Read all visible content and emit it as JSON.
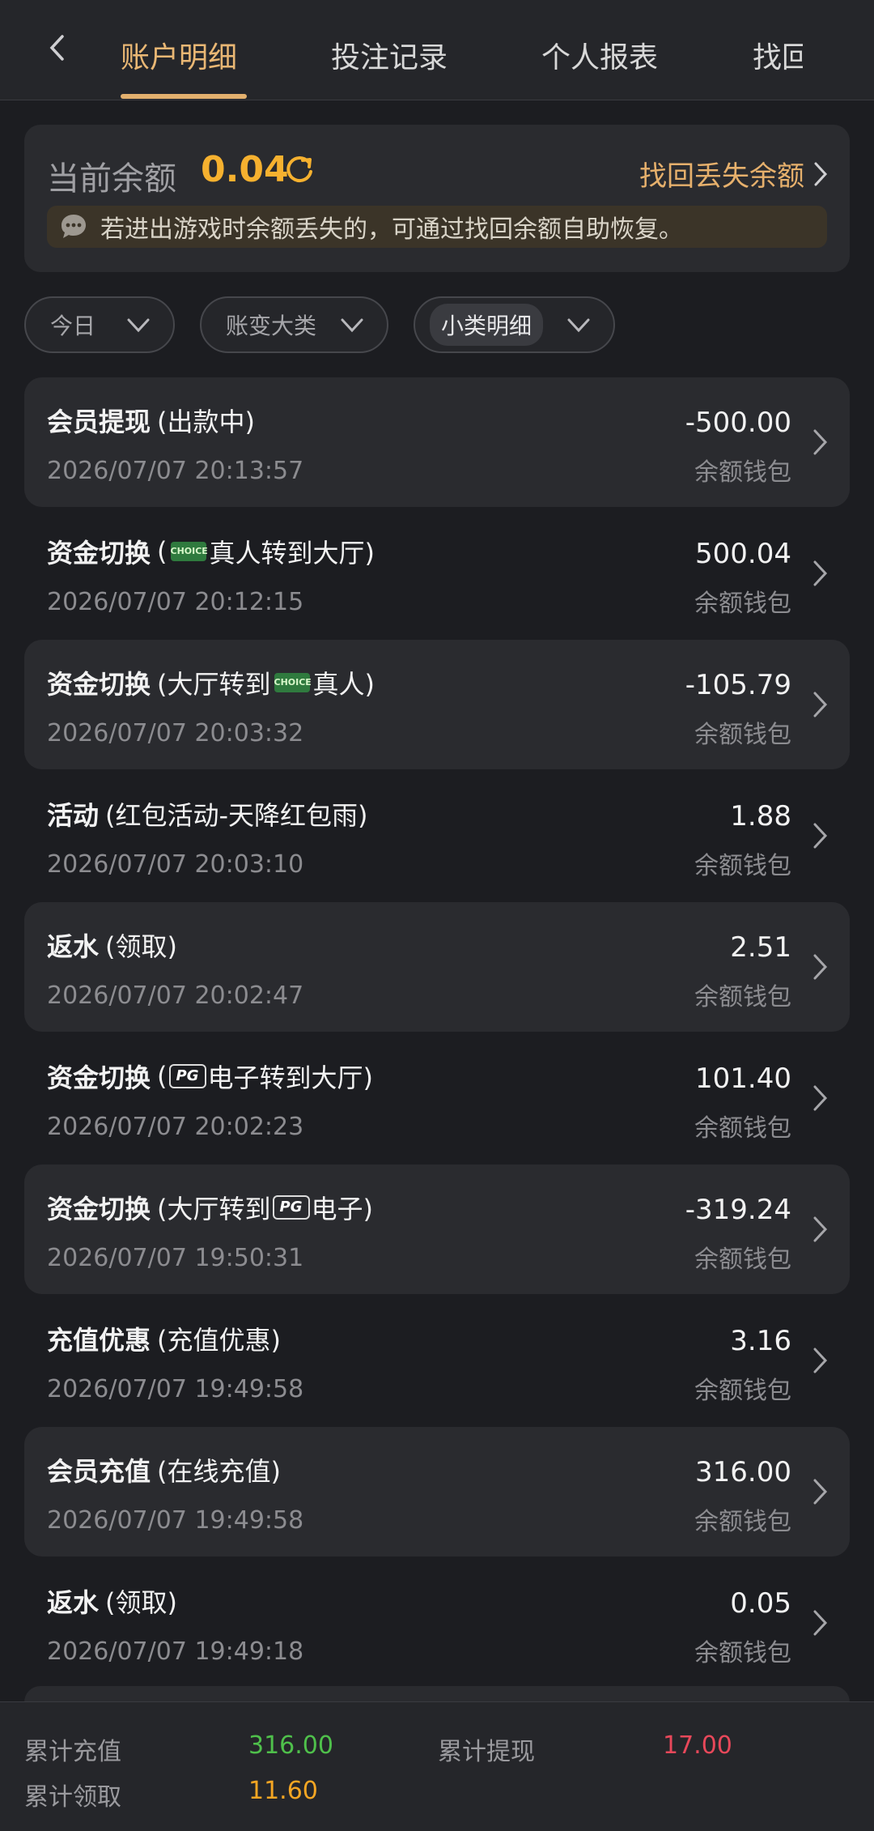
{
  "tabs": [
    {
      "label": "账户明细",
      "active": true
    },
    {
      "label": "投注记录"
    },
    {
      "label": "个人报表"
    },
    {
      "label": "找回"
    }
  ],
  "balance": {
    "label": "当前余额",
    "value": "0.04",
    "recover_link": "找回丢失余额",
    "notice": "若进出游戏时余额丢失的，可通过找回余额自助恢复。"
  },
  "filters": {
    "date": "今日",
    "category": "账变大类",
    "subcategory": "小类明细"
  },
  "records": [
    {
      "type": "会员提现",
      "detail_pre": "(出款中)",
      "detail_post": "",
      "logo": "",
      "time": "2026/07/07 20:13:57",
      "amount": "-500.00",
      "wallet": "余额钱包"
    },
    {
      "type": "资金切换",
      "detail_pre": "(",
      "detail_post": "真人转到大厅)",
      "logo": "choice",
      "time": "2026/07/07 20:12:15",
      "amount": "500.04",
      "wallet": "余额钱包"
    },
    {
      "type": "资金切换",
      "detail_pre": "(大厅转到",
      "detail_post": "真人)",
      "logo": "choice",
      "time": "2026/07/07 20:03:32",
      "amount": "-105.79",
      "wallet": "余额钱包"
    },
    {
      "type": "活动",
      "detail_pre": "(红包活动-天降红包雨)",
      "detail_post": "",
      "logo": "",
      "time": "2026/07/07 20:03:10",
      "amount": "1.88",
      "wallet": "余额钱包"
    },
    {
      "type": "返水",
      "detail_pre": "(领取)",
      "detail_post": "",
      "logo": "",
      "time": "2026/07/07 20:02:47",
      "amount": "2.51",
      "wallet": "余额钱包"
    },
    {
      "type": "资金切换",
      "detail_pre": "(",
      "detail_post": "电子转到大厅)",
      "logo": "pg",
      "time": "2026/07/07 20:02:23",
      "amount": "101.40",
      "wallet": "余额钱包"
    },
    {
      "type": "资金切换",
      "detail_pre": "(大厅转到",
      "detail_post": "电子)",
      "logo": "pg",
      "time": "2026/07/07 19:50:31",
      "amount": "-319.24",
      "wallet": "余额钱包"
    },
    {
      "type": "充值优惠",
      "detail_pre": "(充值优惠)",
      "detail_post": "",
      "logo": "",
      "time": "2026/07/07 19:49:58",
      "amount": "3.16",
      "wallet": "余额钱包"
    },
    {
      "type": "会员充值",
      "detail_pre": "(在线充值)",
      "detail_post": "",
      "logo": "",
      "time": "2026/07/07 19:49:58",
      "amount": "316.00",
      "wallet": "余额钱包"
    },
    {
      "type": "返水",
      "detail_pre": "(领取)",
      "detail_post": "",
      "logo": "",
      "time": "2026/07/07 19:49:18",
      "amount": "0.05",
      "wallet": "余额钱包"
    }
  ],
  "logos": {
    "choice": "CHOICE",
    "pg": "PG"
  },
  "summary": {
    "deposit_label": "累计充值",
    "deposit_value": "316.00",
    "withdraw_label": "累计提现",
    "withdraw_value": "17.00",
    "claim_label": "累计领取",
    "claim_value": "11.60"
  },
  "colors": {
    "accent": "#e9b774",
    "balance": "#f6b12f",
    "deposit": "#4fc04b",
    "withdraw": "#e8485a",
    "claim": "#f5a623"
  }
}
